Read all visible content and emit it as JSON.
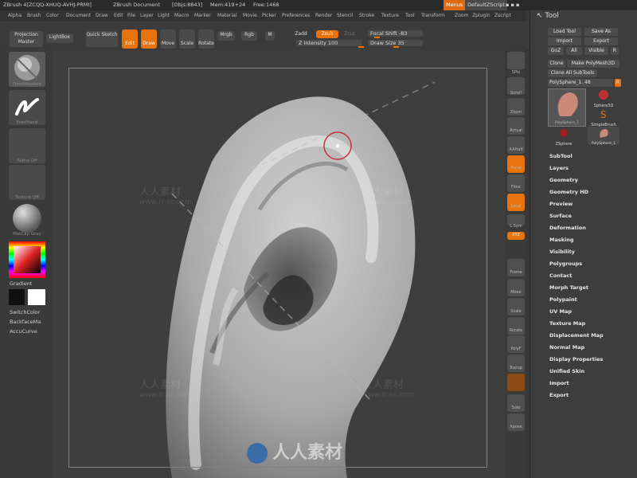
{
  "titlebar": {
    "app_title": "ZBrush 4[ZCQQ-XHUQ-AVHJ-PRMI]",
    "document": "ZBrush Document",
    "objs": "[Objs:8843]",
    "mem": "Mem:419+24",
    "free": "Free:1468",
    "menus_btn": "Menus",
    "script_btn": "DefaultZScript"
  },
  "menubar": [
    "Alpha",
    "Brush",
    "Color",
    "Document",
    "Draw",
    "Edit",
    "File",
    "Layer",
    "Light",
    "Macro",
    "Marker",
    "Material",
    "Movie",
    "Picker",
    "Preferences",
    "Render",
    "Stencil",
    "Stroke",
    "Texture",
    "Tool",
    "Transform",
    "Zoom",
    "Zplugin",
    "Zscript"
  ],
  "shelf": {
    "projection_master": "Projection Master",
    "lightbox": "LightBox",
    "quick_sketch": "Quick Sketch",
    "edit": "Edit",
    "draw": "Draw",
    "move": "Move",
    "scale": "Scale",
    "rotate": "Rotate",
    "mrgb": "Mrgb",
    "rgb": "Rgb",
    "m": "M",
    "zadd": "Zadd",
    "zsub": "Zsub",
    "zcut": "Zcut",
    "z_intensity": "Z Intensity 100",
    "focal_shift": "Focal Shift -83",
    "draw_size": "Draw Size 35"
  },
  "leftshelf": {
    "brush_label": "TrimAdaptive",
    "stroke_label": "FreeHand",
    "alpha_label": "Alpha Off",
    "texture_label": "Texture Off",
    "material_label": "MatCap Gray",
    "gradient": "Gradient",
    "switchcolor": "SwitchColor",
    "backface": "BackfaceMa",
    "accucurve": "AccuCurve"
  },
  "righttools": [
    "SPix",
    "Scroll",
    "Zoom",
    "Actual",
    "AAHalf",
    "Persp",
    "Floor",
    "Local",
    "L.Sym",
    "XYZ",
    "Frame",
    "Move",
    "Scale",
    "Rotate",
    "PolyF",
    "Transp",
    "Ghost",
    "Solo",
    "Xpose"
  ],
  "toolpanel": {
    "title": "Tool",
    "load_tool": "Load Tool",
    "save_as": "Save As",
    "import": "Import",
    "export": "Export",
    "goz": "GoZ",
    "all": "All",
    "visible": "Visible",
    "r": "R",
    "clone": "Clone",
    "make_polymesh": "Make PolyMesh3D",
    "clone_all": "Clone All SubTools",
    "current_tool": "PolySphere_1. 48",
    "thumbs": [
      "PolySphere_1",
      "Sphere3D",
      "SimpleBrush",
      "ZSphere",
      "PolySphere_1"
    ],
    "menus": [
      "SubTool",
      "Layers",
      "Geometry",
      "Geometry HD",
      "Preview",
      "Surface",
      "Deformation",
      "Masking",
      "Visibility",
      "Polygroups",
      "Contact",
      "Morph Target",
      "Polypaint",
      "UV Map",
      "Texture Map",
      "Displacement Map",
      "Normal Map",
      "Display Properties",
      "Unified Skin",
      "Import",
      "Export"
    ]
  },
  "watermarks": {
    "cn": "人人素材",
    "url": "www.rr-sc.com"
  },
  "colors": {
    "accent": "#e8720c",
    "background": "#383838"
  }
}
